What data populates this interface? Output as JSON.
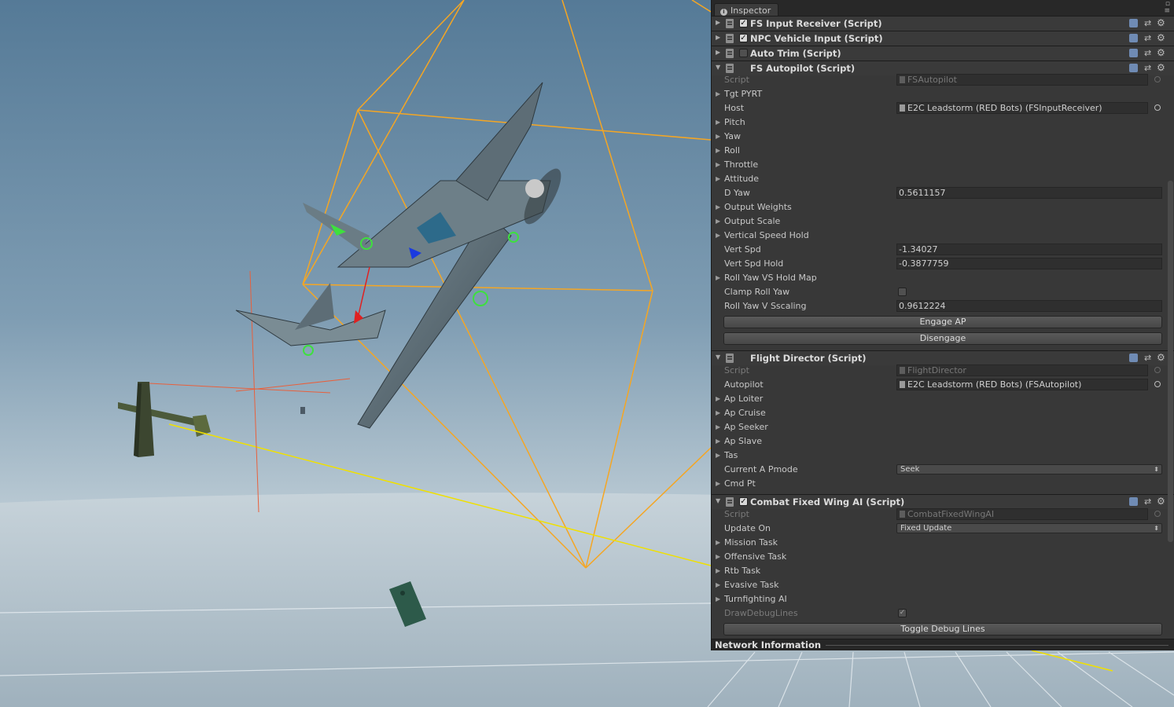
{
  "inspector": {
    "tab_label": "Inspector",
    "components": [
      {
        "title": "FS Input Receiver (Script)",
        "enabled": true,
        "has_checkbox": true,
        "expanded": false
      },
      {
        "title": "NPC Vehicle Input (Script)",
        "enabled": true,
        "has_checkbox": true,
        "expanded": false
      },
      {
        "title": "Auto Trim (Script)",
        "enabled": false,
        "has_checkbox": true,
        "expanded": false
      },
      {
        "title": "FS Autopilot (Script)",
        "has_checkbox": false,
        "expanded": true
      },
      {
        "title": "Flight Director (Script)",
        "has_checkbox": false,
        "expanded": true
      },
      {
        "title": "Combat Fixed Wing AI (Script)",
        "enabled": true,
        "has_checkbox": true,
        "expanded": true
      }
    ],
    "autopilot": {
      "script_label": "Script",
      "script_value": "FSAutopilot",
      "tgt_pyrt": "Tgt PYRT",
      "host_label": "Host",
      "host_value": "E2C Leadstorm (RED Bots) (FSInputReceiver)",
      "pitch": "Pitch",
      "yaw": "Yaw",
      "roll": "Roll",
      "throttle": "Throttle",
      "attitude": "Attitude",
      "d_yaw_label": "D Yaw",
      "d_yaw_value": "0.5611157",
      "output_weights": "Output Weights",
      "output_scale": "Output Scale",
      "vertical_speed_hold": "Vertical Speed Hold",
      "vert_spd_label": "Vert Spd",
      "vert_spd_value": "-1.34027",
      "vert_spd_hold_label": "Vert Spd Hold",
      "vert_spd_hold_value": "-0.3877759",
      "roll_yaw_vs_hold_map": "Roll Yaw VS Hold Map",
      "clamp_roll_yaw_label": "Clamp Roll Yaw",
      "roll_yaw_v_scaling_label": "Roll Yaw V Sscaling",
      "roll_yaw_v_scaling_value": "0.9612224",
      "engage_button": "Engage AP",
      "disengage_button": "Disengage"
    },
    "flight_director": {
      "script_label": "Script",
      "script_value": "FlightDirector",
      "autopilot_label": "Autopilot",
      "autopilot_value": "E2C Leadstorm (RED Bots) (FSAutopilot)",
      "ap_loiter": "Ap Loiter",
      "ap_cruise": "Ap Cruise",
      "ap_seeker": "Ap Seeker",
      "ap_slave": "Ap Slave",
      "tas": "Tas",
      "current_apmode_label": "Current A Pmode",
      "current_apmode_value": "Seek",
      "cmd_pt": "Cmd Pt"
    },
    "combat_ai": {
      "script_label": "Script",
      "script_value": "CombatFixedWingAI",
      "update_on_label": "Update On",
      "update_on_value": "Fixed Update",
      "mission_task": "Mission Task",
      "offensive_task": "Offensive Task",
      "rtb_task": "Rtb Task",
      "evasive_task": "Evasive Task",
      "turnfighting_ai": "Turnfighting AI",
      "draw_debug_lines_label": "DrawDebugLines",
      "draw_debug_lines_checked": true,
      "toggle_debug_button": "Toggle Debug Lines"
    },
    "network_information": "Network Information"
  },
  "colors": {
    "panel_bg": "#383838",
    "gizmo_orange": "#f5a623",
    "selection_yellow": "#f0e000"
  }
}
